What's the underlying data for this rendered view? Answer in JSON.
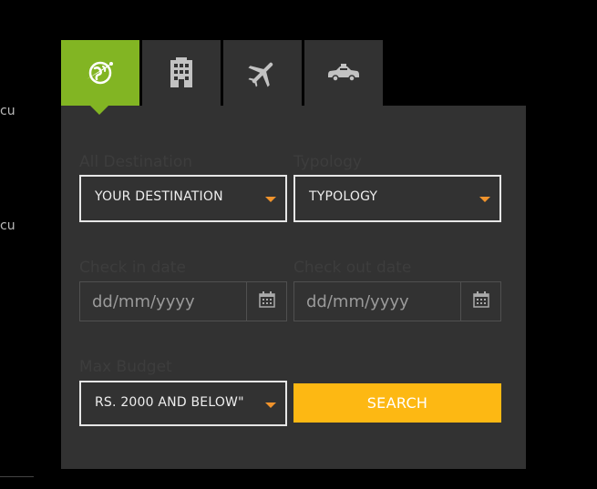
{
  "edge": {
    "text1": "cu",
    "text2": "cu"
  },
  "tabs": [
    {
      "name": "globe-icon"
    },
    {
      "name": "building-icon"
    },
    {
      "name": "airplane-icon"
    },
    {
      "name": "taxi-icon"
    }
  ],
  "colors": {
    "active_tab": "#82b523",
    "panel": "#323232",
    "search_button": "#fdb813",
    "caret": "#f0932c"
  },
  "form": {
    "destination_label": "All Destination",
    "destination_value": "YOUR DESTINATION",
    "typology_label": "Typology",
    "typology_value": "TYPOLOGY",
    "checkin_label": "Check in date",
    "checkin_placeholder": "dd/mm/yyyy",
    "checkout_label": "Check out date",
    "checkout_placeholder": "dd/mm/yyyy",
    "budget_label": "Max Budget",
    "budget_value": "RS. 2000 AND BELOW\"",
    "search_label": "SEARCH"
  }
}
